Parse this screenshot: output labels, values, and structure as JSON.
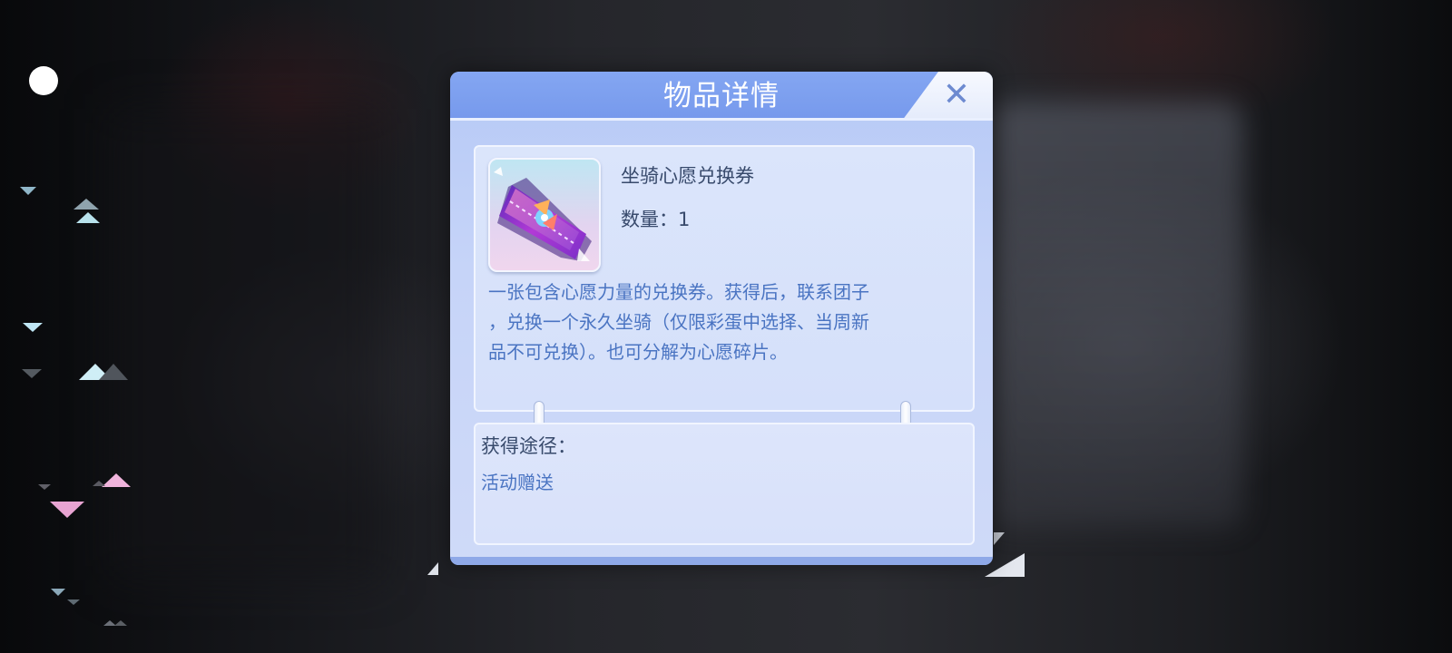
{
  "dialog": {
    "title": "物品详情",
    "close_icon": "close-icon"
  },
  "item": {
    "icon": "mount-wish-ticket-icon",
    "name": "坐骑心愿兑换券",
    "quantity_label": "数量：",
    "quantity": "1",
    "description_lines": [
      "一张包含心愿力量的兑换券。获得后，联系团子",
      "，兑换一个永久坐骑（仅限彩蛋中选择、当周新",
      "品不可兑换）。也可分解为心愿碎片。"
    ]
  },
  "source": {
    "label": "获得途径：",
    "value": "活动赠送"
  },
  "colors": {
    "header": "#7b9df0",
    "panel": "#d8e2fa",
    "title_text": "#384a6c",
    "desc_text": "#4a74c2",
    "close_x": "#6d8ad0"
  }
}
